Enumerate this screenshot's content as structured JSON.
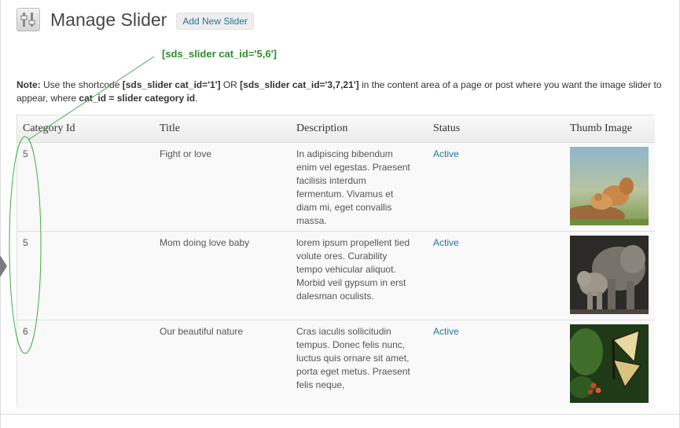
{
  "header": {
    "title": "Manage Slider",
    "add_new_label": "Add New Slider"
  },
  "callout": {
    "text": "[sds_slider cat_id='5,6']"
  },
  "note": {
    "label": "Note:",
    "text1": " Use the shortcode ",
    "code1": "[sds_slider cat_id='1']",
    "text2": " OR ",
    "code2": "[sds_slider cat_id='3,7,21']",
    "text3": " in the content area of a page or post where you want the image slider to appear, where ",
    "code3": "cat_id = slider category id",
    "text4": "."
  },
  "table": {
    "headers": {
      "category_id": "Category Id",
      "title": "Title",
      "description": "Description",
      "status": "Status",
      "thumb": "Thumb Image"
    },
    "rows": [
      {
        "category_id": "5",
        "title": "Fight or love",
        "description": "In adipiscing bibendum enim vel egestas. Praesent facilisis interdum fermentum. Vivamus et diam mi, eget convallis massa.",
        "status": "Active",
        "thumb_icon": "prairie-dogs-photo"
      },
      {
        "category_id": "5",
        "title": "Mom doing love baby",
        "description": "lorem ipsum propellent tied volute ores. Curability tempo vehicular aliquot. Morbid veil gypsum in erst dalesman oculists.",
        "status": "Active",
        "thumb_icon": "elephants-photo"
      },
      {
        "category_id": "6",
        "title": "Our beautiful nature",
        "description": "Cras iaculis sollicitudin tempus. Donec felis nunc, luctus quis ornare sit amet, porta eget metus. Praesent felis neque,",
        "status": "Active",
        "thumb_icon": "butterfly-photo"
      }
    ]
  },
  "colors": {
    "link": "#21759b",
    "callout_green": "#2e8b2e",
    "annotation_green": "#3fae3f"
  }
}
